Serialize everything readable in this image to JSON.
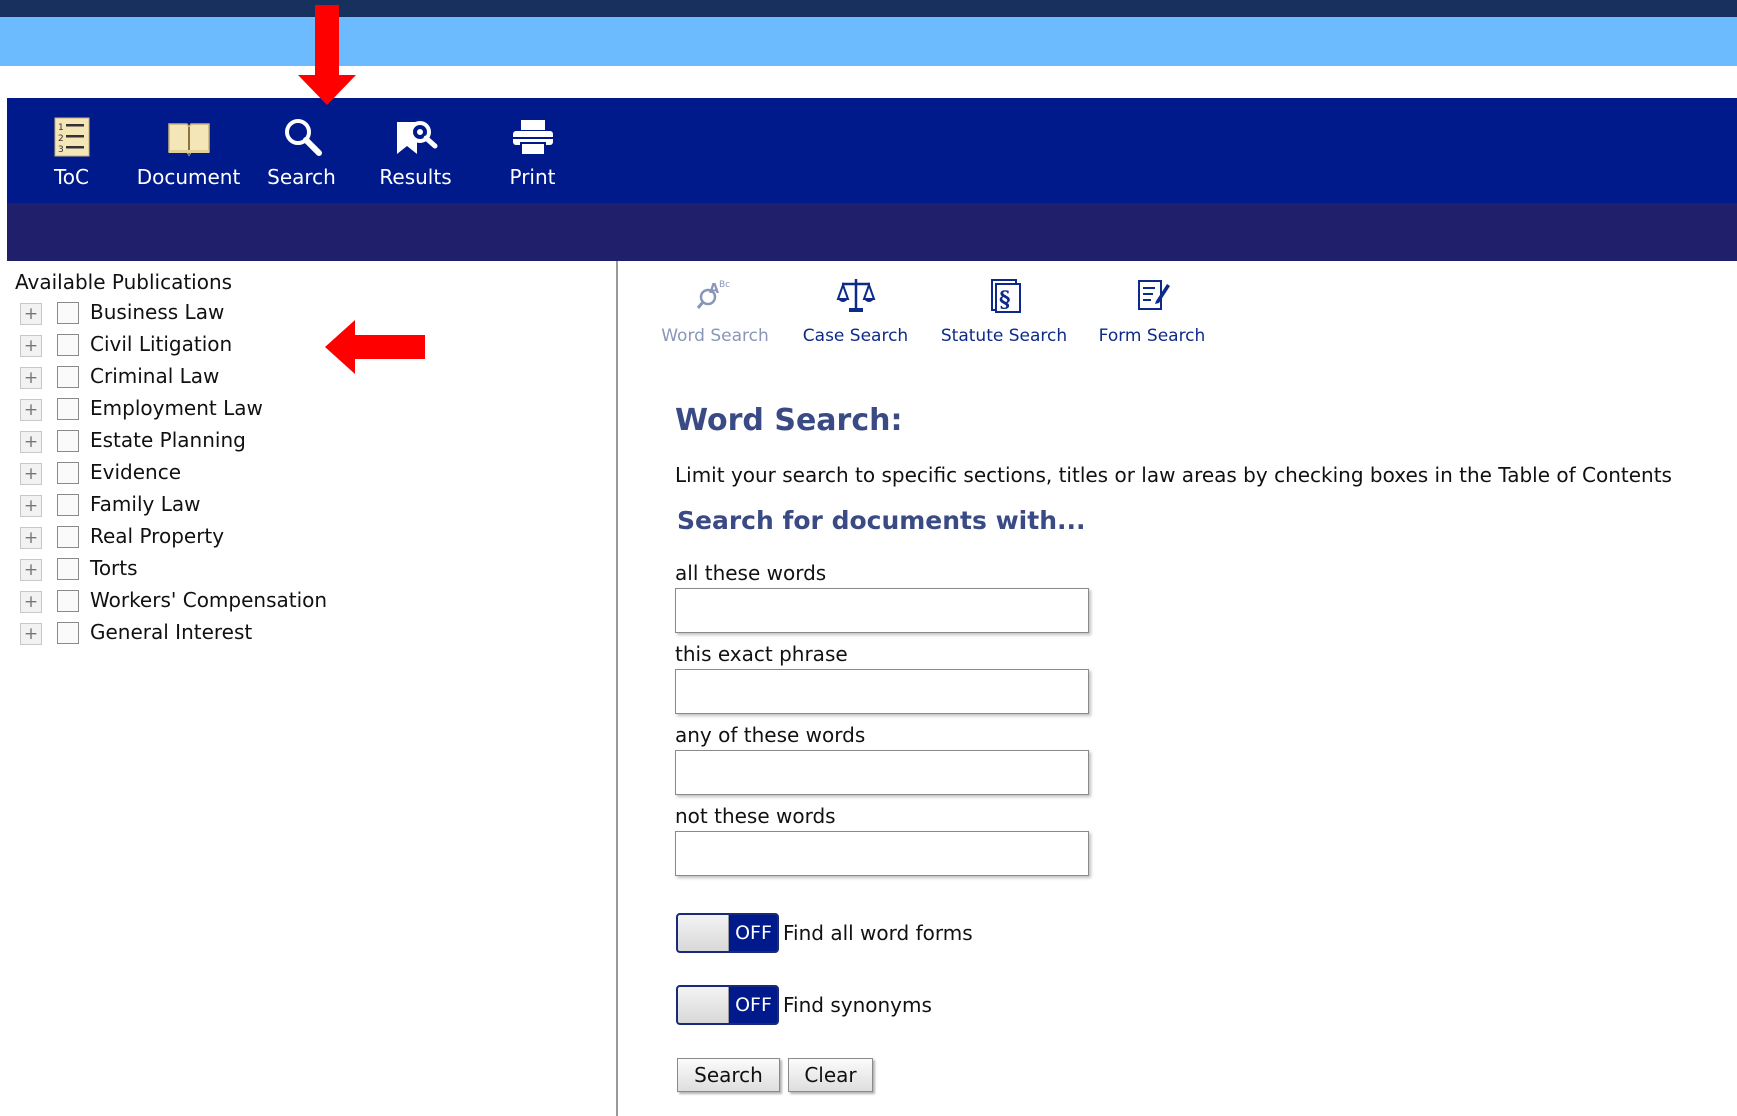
{
  "toolbar": {
    "buttons": [
      {
        "label": "ToC",
        "icon": "toc-icon"
      },
      {
        "label": "Document",
        "icon": "book-icon"
      },
      {
        "label": "Search",
        "icon": "magnifier-icon"
      },
      {
        "label": "Results",
        "icon": "results-icon"
      },
      {
        "label": "Print",
        "icon": "printer-icon"
      }
    ]
  },
  "left_pane": {
    "title": "Available Publications",
    "items": [
      "Business Law",
      "Civil Litigation",
      "Criminal Law",
      "Employment Law",
      "Estate Planning",
      "Evidence",
      "Family Law",
      "Real Property",
      "Torts",
      "Workers' Compensation",
      "General Interest"
    ]
  },
  "search_types": [
    {
      "label": "Word Search",
      "icon": "word-search-icon",
      "active": true
    },
    {
      "label": "Case Search",
      "icon": "scales-icon",
      "active": false
    },
    {
      "label": "Statute Search",
      "icon": "section-icon",
      "active": false
    },
    {
      "label": "Form Search",
      "icon": "form-edit-icon",
      "active": false
    }
  ],
  "word_search": {
    "title": "Word Search:",
    "description": "Limit your search to specific sections, titles or law areas by checking boxes in the Table of Contents",
    "subtitle": "Search for documents with...",
    "fields": [
      {
        "label": "all these words",
        "value": ""
      },
      {
        "label": "this exact phrase",
        "value": ""
      },
      {
        "label": "any of these words",
        "value": ""
      },
      {
        "label": "not these words",
        "value": ""
      }
    ],
    "toggles": [
      {
        "state": "OFF",
        "label": "Find all word forms"
      },
      {
        "state": "OFF",
        "label": "Find synonyms"
      }
    ],
    "search_button": "Search",
    "clear_button": "Clear"
  },
  "colors": {
    "toolbar": "#001a8c",
    "subbar": "#1f1f6b",
    "header_light": "#6dbbff",
    "header_dark": "#17305e",
    "arrow": "#ff0000",
    "heading": "#3a4a85"
  }
}
